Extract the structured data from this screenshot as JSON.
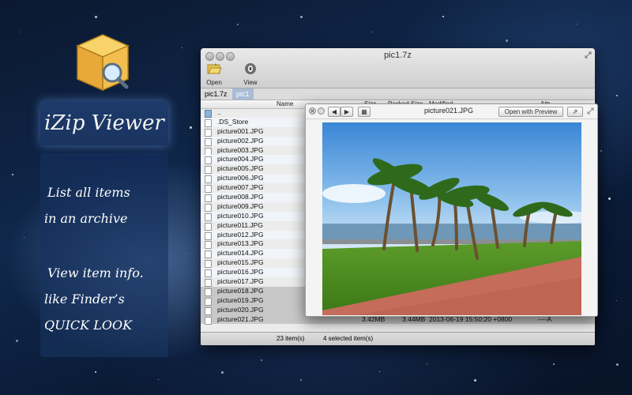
{
  "promo": {
    "app_title": "iZip Viewer",
    "tagline_lines": [
      "List all items",
      "in an archive",
      "View item info.",
      "like Finder’s",
      "QUICK LOOK"
    ]
  },
  "window": {
    "title": "pic1.7z",
    "toolbar": {
      "open_label": "Open",
      "view_label": "View"
    },
    "breadcrumbs": [
      "pic1.7z",
      "pic1"
    ],
    "columns": {
      "name": "Name",
      "size": "Size",
      "packed": "Packed Size",
      "modified": "Modified",
      "attr": "Attr."
    },
    "files": [
      {
        "name": "..",
        "kind": "folder"
      },
      {
        "name": ".DS_Store",
        "kind": "file"
      },
      {
        "name": "picture001.JPG",
        "kind": "file"
      },
      {
        "name": "picture002.JPG",
        "kind": "file"
      },
      {
        "name": "picture003.JPG",
        "kind": "file"
      },
      {
        "name": "picture004.JPG",
        "kind": "file"
      },
      {
        "name": "picture005.JPG",
        "kind": "file"
      },
      {
        "name": "picture006.JPG",
        "kind": "file"
      },
      {
        "name": "picture007.JPG",
        "kind": "file"
      },
      {
        "name": "picture008.JPG",
        "kind": "file"
      },
      {
        "name": "picture009.JPG",
        "kind": "file"
      },
      {
        "name": "picture010.JPG",
        "kind": "file"
      },
      {
        "name": "picture011.JPG",
        "kind": "file"
      },
      {
        "name": "picture012.JPG",
        "kind": "file"
      },
      {
        "name": "picture013.JPG",
        "kind": "file"
      },
      {
        "name": "picture014.JPG",
        "kind": "file"
      },
      {
        "name": "picture015.JPG",
        "kind": "file"
      },
      {
        "name": "picture016.JPG",
        "kind": "file"
      },
      {
        "name": "picture017.JPG",
        "kind": "file"
      },
      {
        "name": "picture018.JPG",
        "kind": "file",
        "selected": true
      },
      {
        "name": "picture019.JPG",
        "kind": "file",
        "selected": true
      },
      {
        "name": "picture020.JPG",
        "kind": "file",
        "selected": true
      },
      {
        "name": "picture021.JPG",
        "kind": "file",
        "selected": true,
        "size": "3.42MB",
        "packed": "3.44MB",
        "modified": "2013-06-19 15:50:20 +0800",
        "attr": "----A"
      }
    ],
    "status": {
      "items": "23 item(s)",
      "selected": "4 selected item(s)"
    }
  },
  "quicklook": {
    "title": "picture021.JPG",
    "open_with": "Open with Preview"
  },
  "colors": {
    "selection": "#c8c8c8",
    "breadcrumb_active": "#a9bcd6",
    "banner": "#1d3a6a"
  }
}
